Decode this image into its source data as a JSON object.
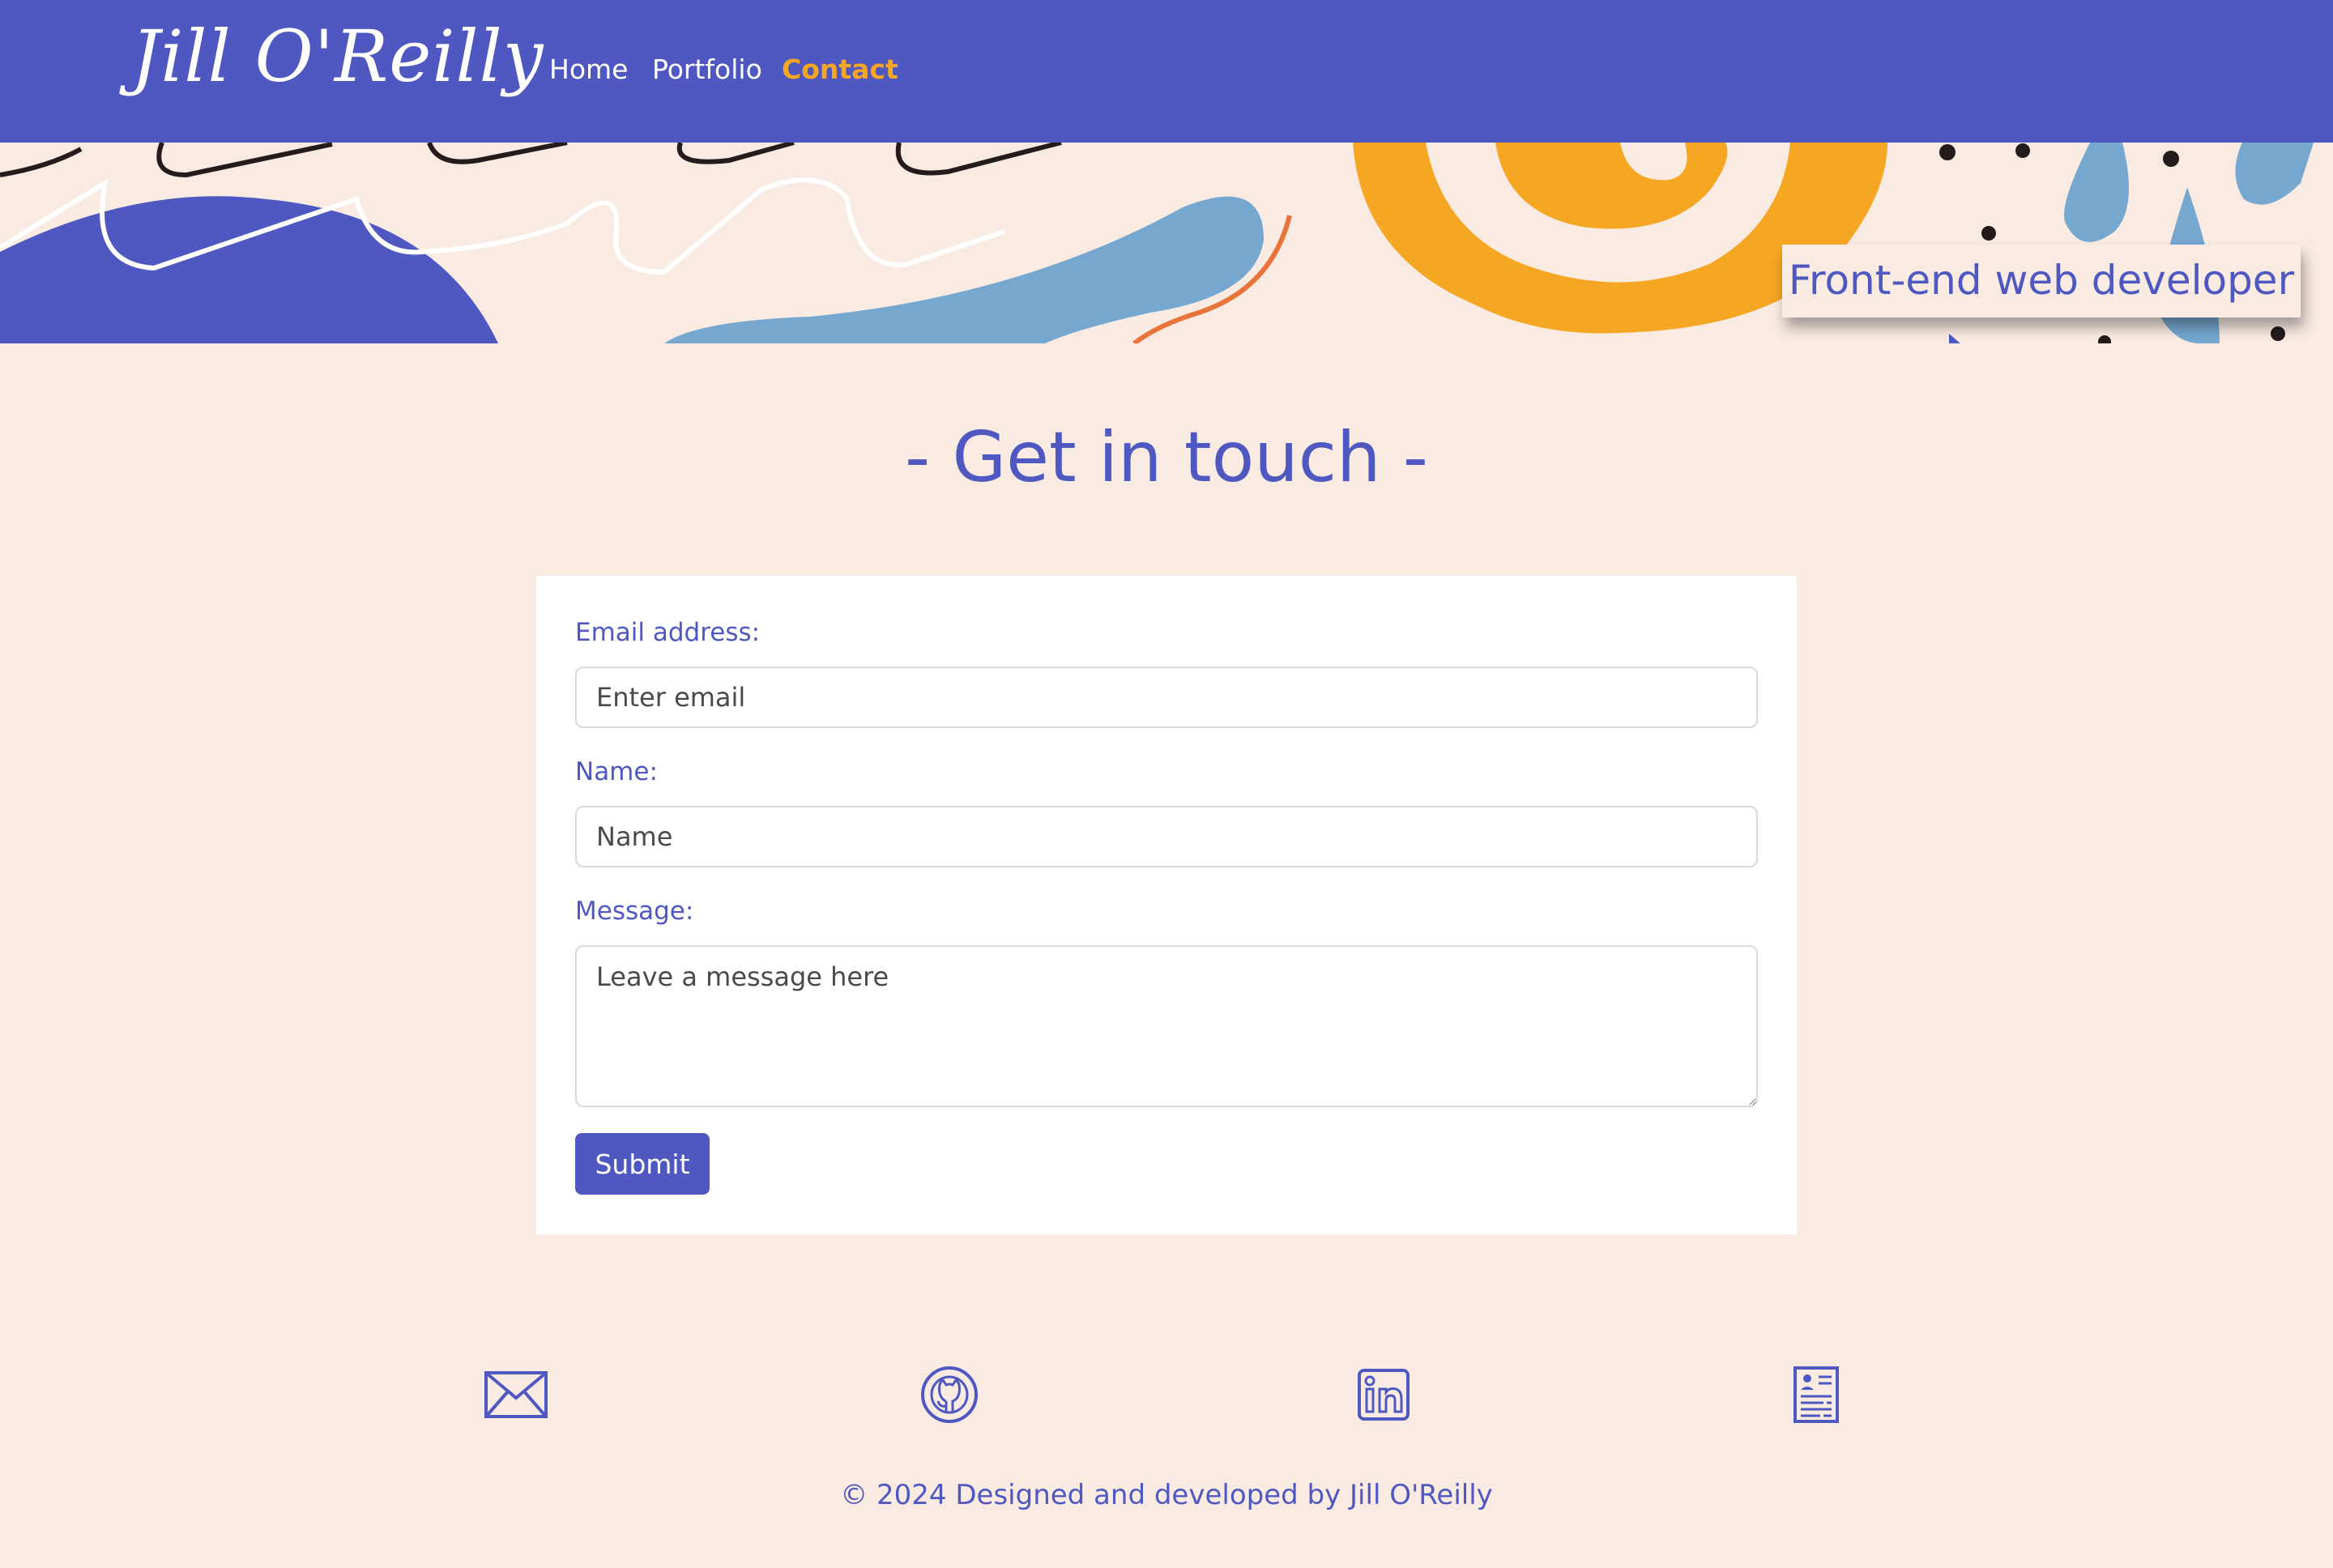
{
  "brand": {
    "name": "Jill O'Reilly"
  },
  "nav": {
    "home": "Home",
    "portfolio": "Portfolio",
    "contact": "Contact"
  },
  "hero": {
    "tagline": "Front-end web developer"
  },
  "page": {
    "heading": "- Get in touch -"
  },
  "form": {
    "email_label": "Email address:",
    "email_placeholder": "Enter email",
    "name_label": "Name:",
    "name_placeholder": "Name",
    "message_label": "Message:",
    "message_placeholder": "Leave a message here",
    "submit_label": "Submit"
  },
  "social": {
    "icons": [
      "envelope-icon",
      "github-icon",
      "linkedin-icon",
      "resume-icon"
    ]
  },
  "footer": {
    "text": "© 2024 Designed and developed by Jill O'Reilly"
  },
  "colors": {
    "primary": "#4f58c0",
    "accent": "#f5a623",
    "background": "#f9ebe2",
    "light_blue": "#76a7cf",
    "orange_stroke": "#e8743b"
  }
}
